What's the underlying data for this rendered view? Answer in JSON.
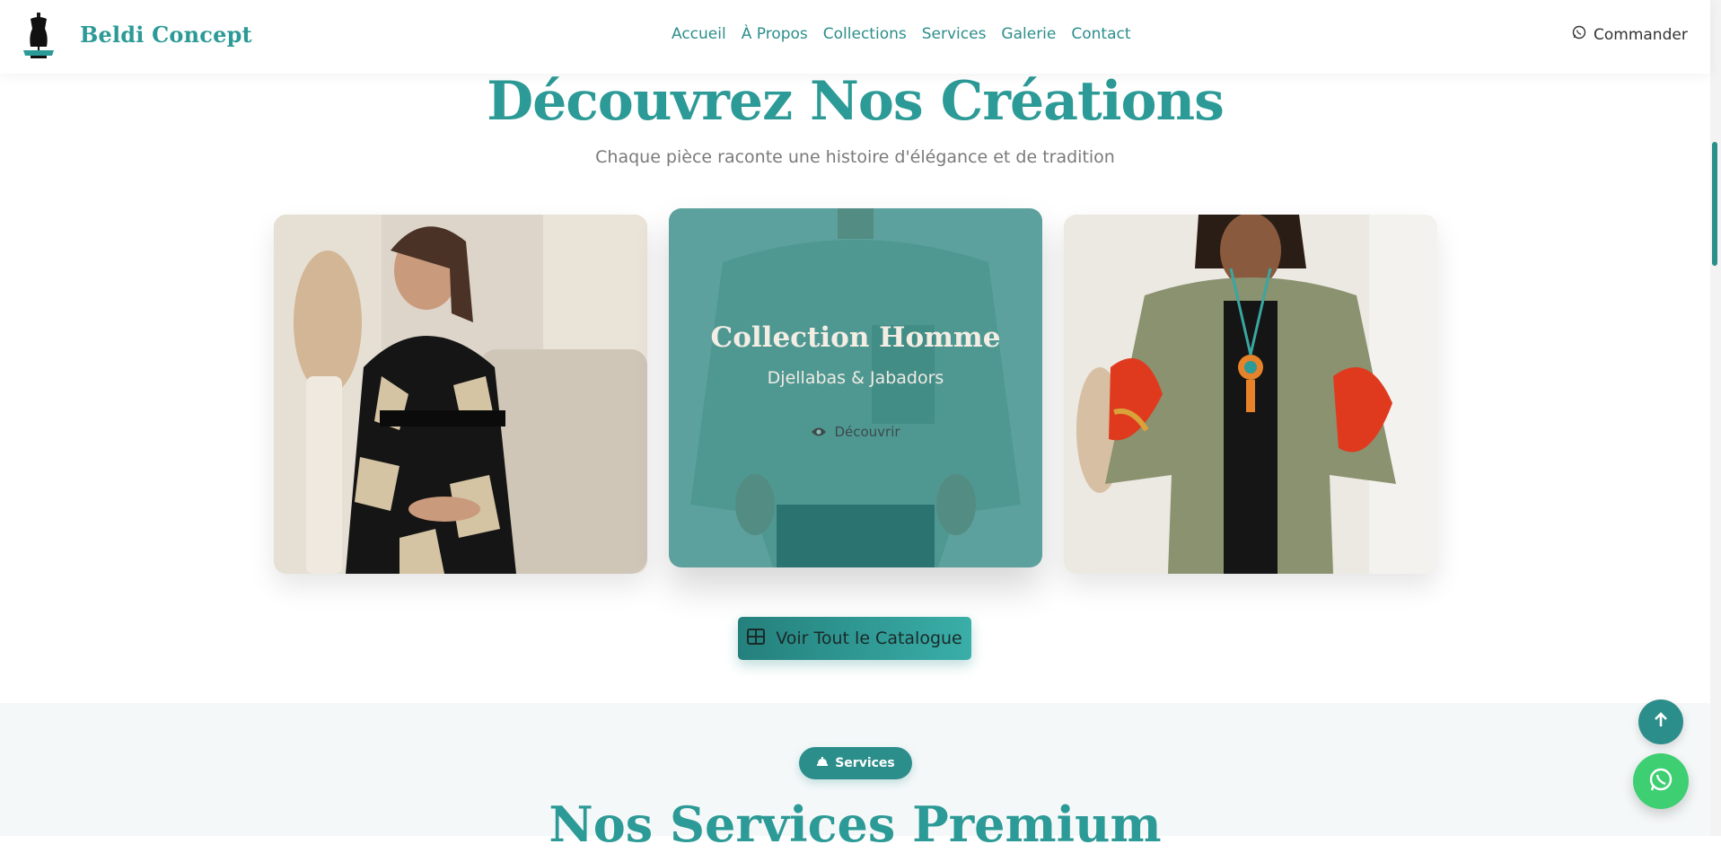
{
  "brand": {
    "name": "Beldi Concept",
    "logo_icon": "dress-form-icon"
  },
  "nav": {
    "links": [
      "Accueil",
      "À Propos",
      "Collections",
      "Services",
      "Galerie",
      "Contact"
    ],
    "order_label": "Commander",
    "order_icon": "whatsapp-icon"
  },
  "hero": {
    "title": "Découvrez Nos Créations",
    "subtitle": "Chaque pièce raconte une histoire d'élégance et de tradition"
  },
  "cards": [
    {
      "image": "woman-black-embroidered-caftan"
    },
    {
      "image": "man-linen-shirt",
      "overlay_title": "Collection Homme",
      "overlay_subtitle": "Djellabas & Jabadors",
      "overlay_button": "Découvrir",
      "overlay_icon": "eye-icon"
    },
    {
      "image": "woman-green-kimono-red-flowers"
    }
  ],
  "catalog_button": {
    "label": "Voir Tout le Catalogue",
    "icon": "grid-icon"
  },
  "services": {
    "badge_label": "Services",
    "badge_icon": "service-bell-icon",
    "title": "Nos Services Premium"
  },
  "floating": {
    "top_icon": "arrow-up-icon",
    "chat_icon": "whatsapp-icon"
  },
  "colors": {
    "accent": "#2c8e8a",
    "accent_light": "#2c9a96",
    "whatsapp": "#3fcf73"
  }
}
